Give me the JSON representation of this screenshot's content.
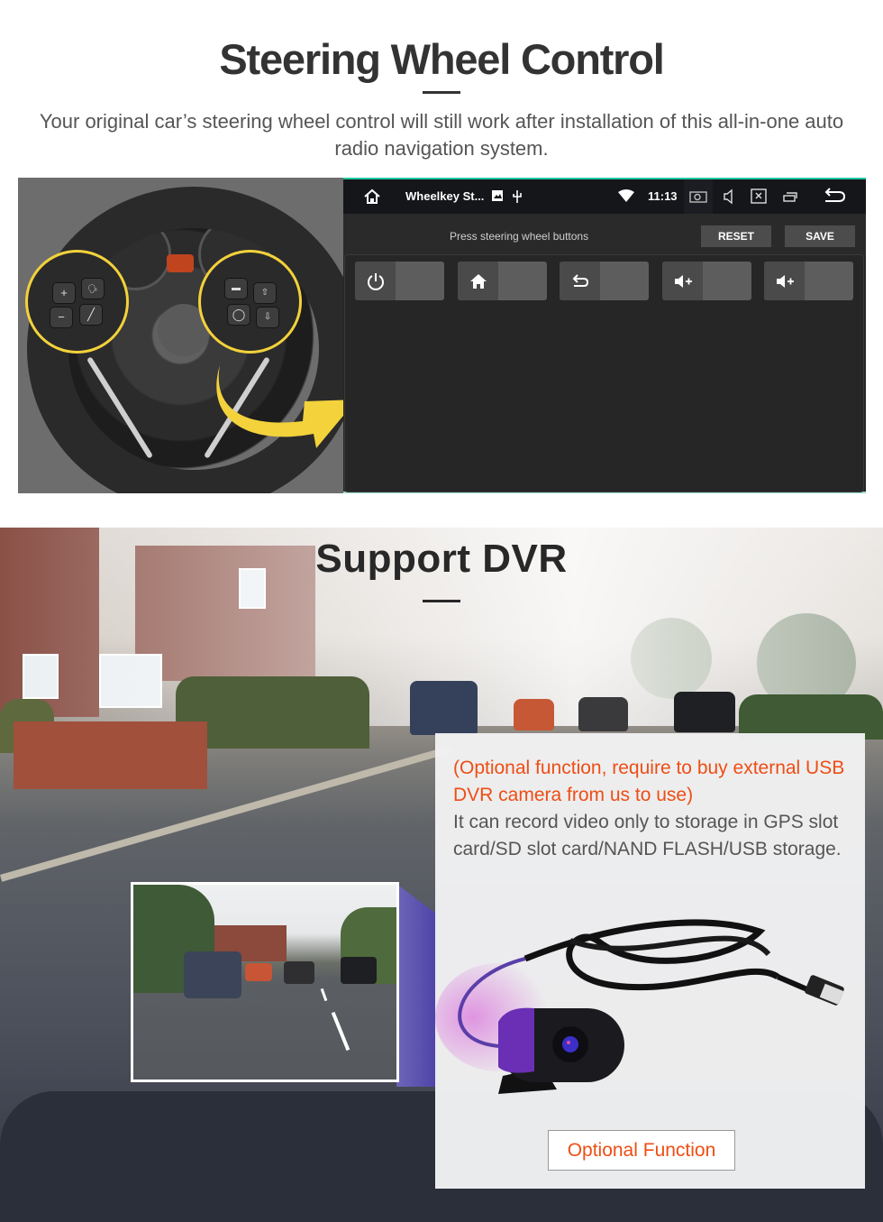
{
  "steering_section": {
    "title": "Steering Wheel Control",
    "description": "Your original car’s steering wheel control will still work after installation of this all-in-one auto radio navigation system.",
    "photo": {
      "left_buttons": [
        "+",
        "−",
        "voice",
        "call"
      ],
      "right_buttons": [
        "mode",
        "up",
        "source",
        "down"
      ]
    },
    "head_unit": {
      "status_bar": {
        "home_icon": "home-icon",
        "app_title": "Wheelkey St...",
        "notification_icons": [
          "image-icon",
          "usb-icon"
        ],
        "wifi_icon": "wifi-icon",
        "time": "11:13",
        "system_icons": [
          "screenshot-icon",
          "volume-icon",
          "close-window-icon",
          "recent-apps-icon",
          "back-icon"
        ]
      },
      "toolbar": {
        "hint": "Press steering wheel buttons",
        "reset_label": "RESET",
        "save_label": "SAVE"
      },
      "keys": [
        {
          "icon": "power-icon",
          "value": ""
        },
        {
          "icon": "home-icon",
          "value": ""
        },
        {
          "icon": "back-icon",
          "value": ""
        },
        {
          "icon": "volume-up-icon",
          "value": ""
        },
        {
          "icon": "volume-up-icon",
          "value": ""
        }
      ]
    }
  },
  "dvr_section": {
    "title": "Support DVR",
    "note": "(Optional function, require to buy external USB DVR camera from us to use)",
    "body": "It can record video only to storage in GPS slot card/SD slot card/NAND FLASH/USB storage.",
    "tag": "Optional Function",
    "colors": {
      "accent": "#ee4e14",
      "highlight_yellow": "#f3d23b",
      "teal_border": "#1ec8a0"
    }
  }
}
